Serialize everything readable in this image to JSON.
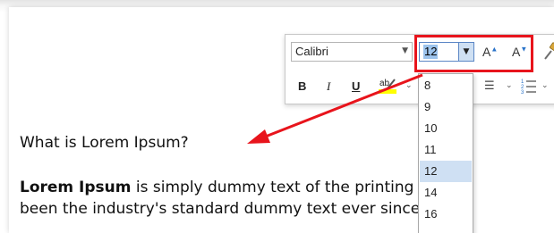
{
  "document": {
    "heading": "What is Lorem Ipsum?",
    "para_bold": "Lorem Ipsum",
    "para_line1_rest": " is simply dummy text of the printing an",
    "para_line2": "been the industry's standard dummy text ever since th"
  },
  "toolbar": {
    "font_name": "Calibri",
    "font_size": "12",
    "grow_label": "A",
    "shrink_label": "A",
    "bold_label": "B",
    "italic_label": "I",
    "underline_label": "U",
    "highlight_label": "ab"
  },
  "size_list": {
    "options": [
      "8",
      "9",
      "10",
      "11",
      "12",
      "14",
      "16"
    ],
    "selected": "12"
  },
  "colors": {
    "annotation": "#e8141c",
    "selection": "#cfe0f3",
    "highlight_yellow": "#ffff00"
  },
  "icons": {
    "font_dropdown": "chevron-down-icon",
    "grow_font": "grow-font-icon",
    "shrink_font": "shrink-font-icon",
    "format_painter": "format-painter-icon",
    "highlight": "highlighter-icon",
    "bullets": "bullet-list-icon",
    "numbering": "numbered-list-icon"
  }
}
